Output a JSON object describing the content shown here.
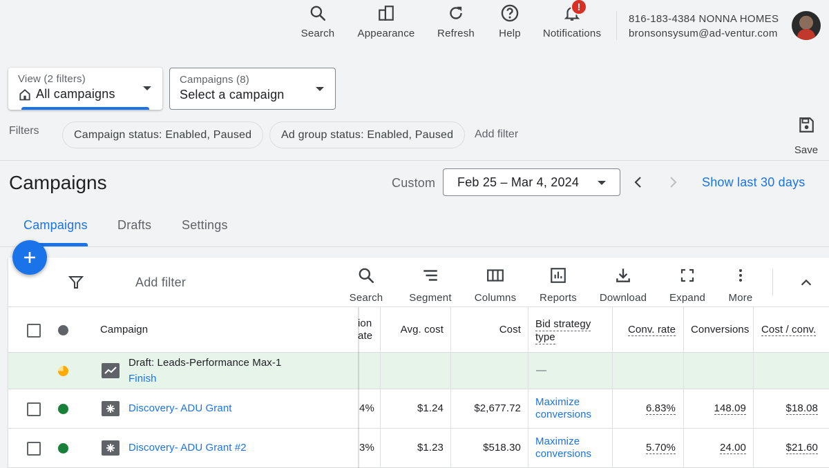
{
  "topbar": {
    "search_label": "Search",
    "appearance_label": "Appearance",
    "refresh_label": "Refresh",
    "help_label": "Help",
    "notifications_label": "Notifications",
    "notifications_badge": "!",
    "account_line1": "816-183-4384 NONNA HOMES",
    "account_line2": "bronsonsysum@ad-ventur.com"
  },
  "view_selector": {
    "small": "View (2 filters)",
    "main": "All campaigns"
  },
  "campaign_selector": {
    "small": "Campaigns (8)",
    "main": "Select a campaign"
  },
  "filters": {
    "label": "Filters",
    "chips": [
      "Campaign status: Enabled, Paused",
      "Ad group status: Enabled, Paused"
    ],
    "add_filter": "Add filter",
    "save_label": "Save"
  },
  "page": {
    "title": "Campaigns",
    "custom_label": "Custom",
    "date_range": "Feb 25 – Mar 4, 2024",
    "show_last": "Show last 30 days"
  },
  "tabs": [
    "Campaigns",
    "Drafts",
    "Settings"
  ],
  "toolbar": {
    "add_filter": "Add filter",
    "search": "Search",
    "segment": "Segment",
    "columns": "Columns",
    "reports": "Reports",
    "download": "Download",
    "expand": "Expand",
    "more": "More"
  },
  "table": {
    "headers": {
      "campaign": "Campaign",
      "conv_partial_1": "ion",
      "conv_partial_2": "ate",
      "avg_cost": "Avg. cost",
      "cost": "Cost",
      "bid_1": "Bid strategy",
      "bid_2": "type",
      "conv_rate": "Conv. rate",
      "conversions": "Conversions",
      "cost_conv": "Cost / conv."
    },
    "draft_row": {
      "name": "Draft: Leads-Performance Max-1",
      "action": "Finish",
      "bid": "—"
    },
    "rows": [
      {
        "name": "Discovery- ADU Grant",
        "partial": "4%",
        "avg_cost": "$1.24",
        "cost": "$2,677.72",
        "bid_1": "Maximize",
        "bid_2": "conversions",
        "conv_rate": "6.83%",
        "conversions": "148.09",
        "cost_conv": "$18.08"
      },
      {
        "name": "Discovery- ADU Grant #2",
        "partial": "3%",
        "avg_cost": "$1.23",
        "cost": "$518.30",
        "bid_1": "Maximize",
        "bid_2": "conversions",
        "conv_rate": "5.70%",
        "conversions": "24.00",
        "cost_conv": "$21.60"
      }
    ]
  },
  "colors": {
    "accent": "#1a73e8",
    "enabled": "#188038",
    "draft": "#f29900",
    "draft_row_bg": "#e6f4ea"
  }
}
